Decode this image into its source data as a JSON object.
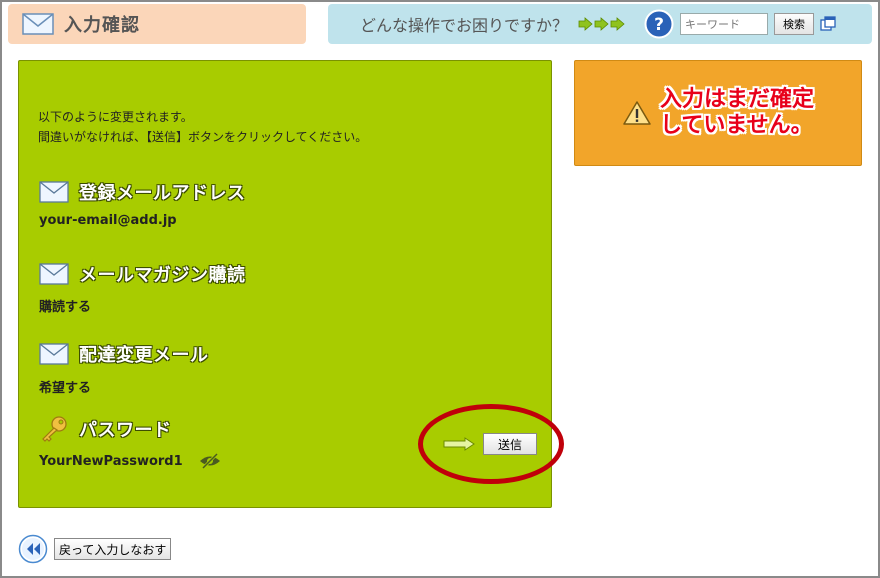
{
  "header": {
    "title": "入力確認",
    "help_question": "どんな操作でお困りですか？",
    "keyword_placeholder": "キーワード",
    "search_label": "検索"
  },
  "main": {
    "intro_line1": "以下のように変更されます。",
    "intro_line2": "間違いがなければ、【送信】ボタンをクリックしてください。",
    "email_label": "登録メールアドレス",
    "email_value": "your-email@add.jp",
    "magazine_label": "メールマガジン購読",
    "magazine_value": "購読する",
    "delivery_label": "配達変更メール",
    "delivery_value": "希望する",
    "password_label": "パスワード",
    "password_value": "YourNewPassword1",
    "send_label": "送信"
  },
  "warning": {
    "line1": "入力はまだ確定",
    "line2": "していません。"
  },
  "footer": {
    "back_label": "戻って入力しなおす"
  },
  "colors": {
    "panel_green": "#a8cc00",
    "warning_orange": "#f2a52a",
    "warning_text": "#e8001a",
    "annotation_ring": "#c0000a",
    "title_tab": "#fbd6b9",
    "help_bar": "#bfe3ec"
  }
}
